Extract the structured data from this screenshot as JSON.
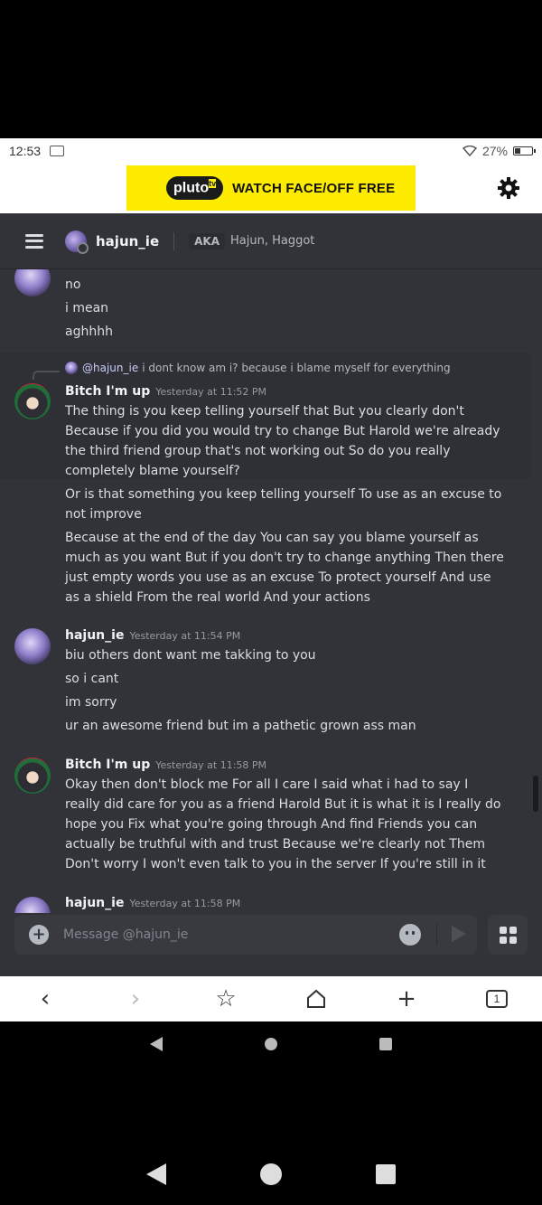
{
  "status": {
    "time": "12:53",
    "battery": "27%"
  },
  "ad": {
    "logo": "pluto",
    "logo_sup": "tv",
    "text": "WATCH FACE/OFF FREE"
  },
  "header": {
    "username": "hajun_ie",
    "aka_label": "AKA",
    "nicknames": "Hajun, Haggot"
  },
  "messages": {
    "top_lines": [
      "no",
      "i mean",
      "aghhhh"
    ],
    "m1": {
      "reply_user": "@hajun_ie",
      "reply_text": "i dont know am i? because i blame myself for everything",
      "author": "Bitch I'm up",
      "timestamp": "Yesterday at 11:52 PM",
      "lines": [
        "The thing is you keep telling yourself that But you clearly don't",
        "Because if you did you would try to change But Harold we're already",
        "the third friend group that's not working out So do you really",
        "completely blame yourself?",
        "Or is that something you keep telling yourself To use as an excuse to",
        "not improve",
        "Because at the end of the day You can say you blame yourself as",
        "much as you want But if you don't try to change anything Then there",
        "just empty words you use as an excuse To protect yourself And use",
        "as a shield From the real world And your actions"
      ]
    },
    "m2": {
      "author": "hajun_ie",
      "timestamp": "Yesterday at 11:54 PM",
      "lines": [
        "biu others dont want me takking to you",
        "so i cant",
        "im sorry",
        "ur an awesome friend but im a pathetic grown ass man"
      ]
    },
    "m3": {
      "author": "Bitch I'm up",
      "timestamp": "Yesterday at 11:58 PM",
      "lines": [
        "Okay then don't block me For all I care I said what i had to say I",
        "really did care for you as a friend Harold But it is what it is I really do",
        "hope you Fix what you're going through And find Friends you can",
        "actually be truthful with and trust Because we're clearly not Them",
        "Don't worry I won't even talk to you in the server If you're still in it"
      ]
    },
    "m4": {
      "author": "hajun_ie",
      "timestamp": "Yesterday at 11:58 PM"
    }
  },
  "composer": {
    "placeholder": "Message @hajun_ie"
  },
  "browser": {
    "tab_count": "1"
  }
}
